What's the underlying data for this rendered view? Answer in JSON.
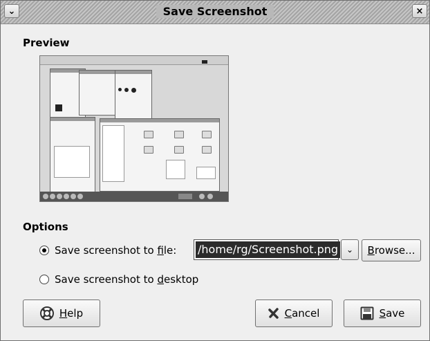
{
  "window": {
    "title": "Save Screenshot",
    "menu_icon": "chevron-down-icon",
    "close_icon": "close-icon"
  },
  "preview": {
    "heading": "Preview"
  },
  "options": {
    "heading": "Options",
    "save_to_file": {
      "pre": "Save screenshot to ",
      "accel": "f",
      "post": "ile:",
      "selected": true
    },
    "save_to_desktop": {
      "pre": "Save screenshot to ",
      "accel": "d",
      "post": "esktop",
      "selected": false
    },
    "file_path": "/home/rg/Screenshot.png",
    "browse": {
      "accel": "B",
      "rest": "rowse..."
    }
  },
  "buttons": {
    "help": {
      "accel": "H",
      "rest": "elp",
      "icon": "help-icon"
    },
    "cancel": {
      "accel": "C",
      "rest": "ancel",
      "icon": "cancel-x-icon"
    },
    "save": {
      "accel": "S",
      "rest": "ave",
      "icon": "floppy-disk-icon"
    }
  }
}
